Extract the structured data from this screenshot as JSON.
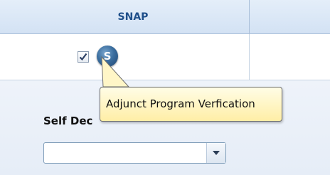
{
  "grid": {
    "header": {
      "snap_label": "SNAP"
    },
    "row": {
      "checkbox_checked": true,
      "checkbox_glyph": "☑",
      "badge_letter": "S",
      "badge_color": "#3b6e9f"
    }
  },
  "tooltip": {
    "text": "Adjunct Program Verfication",
    "background": "#fff3b8"
  },
  "form": {
    "self_declaration_label": "Self Dec",
    "select_value": ""
  },
  "icons": {
    "checkbox": "checkbox-icon",
    "dropdown": "chevron-down-icon"
  }
}
